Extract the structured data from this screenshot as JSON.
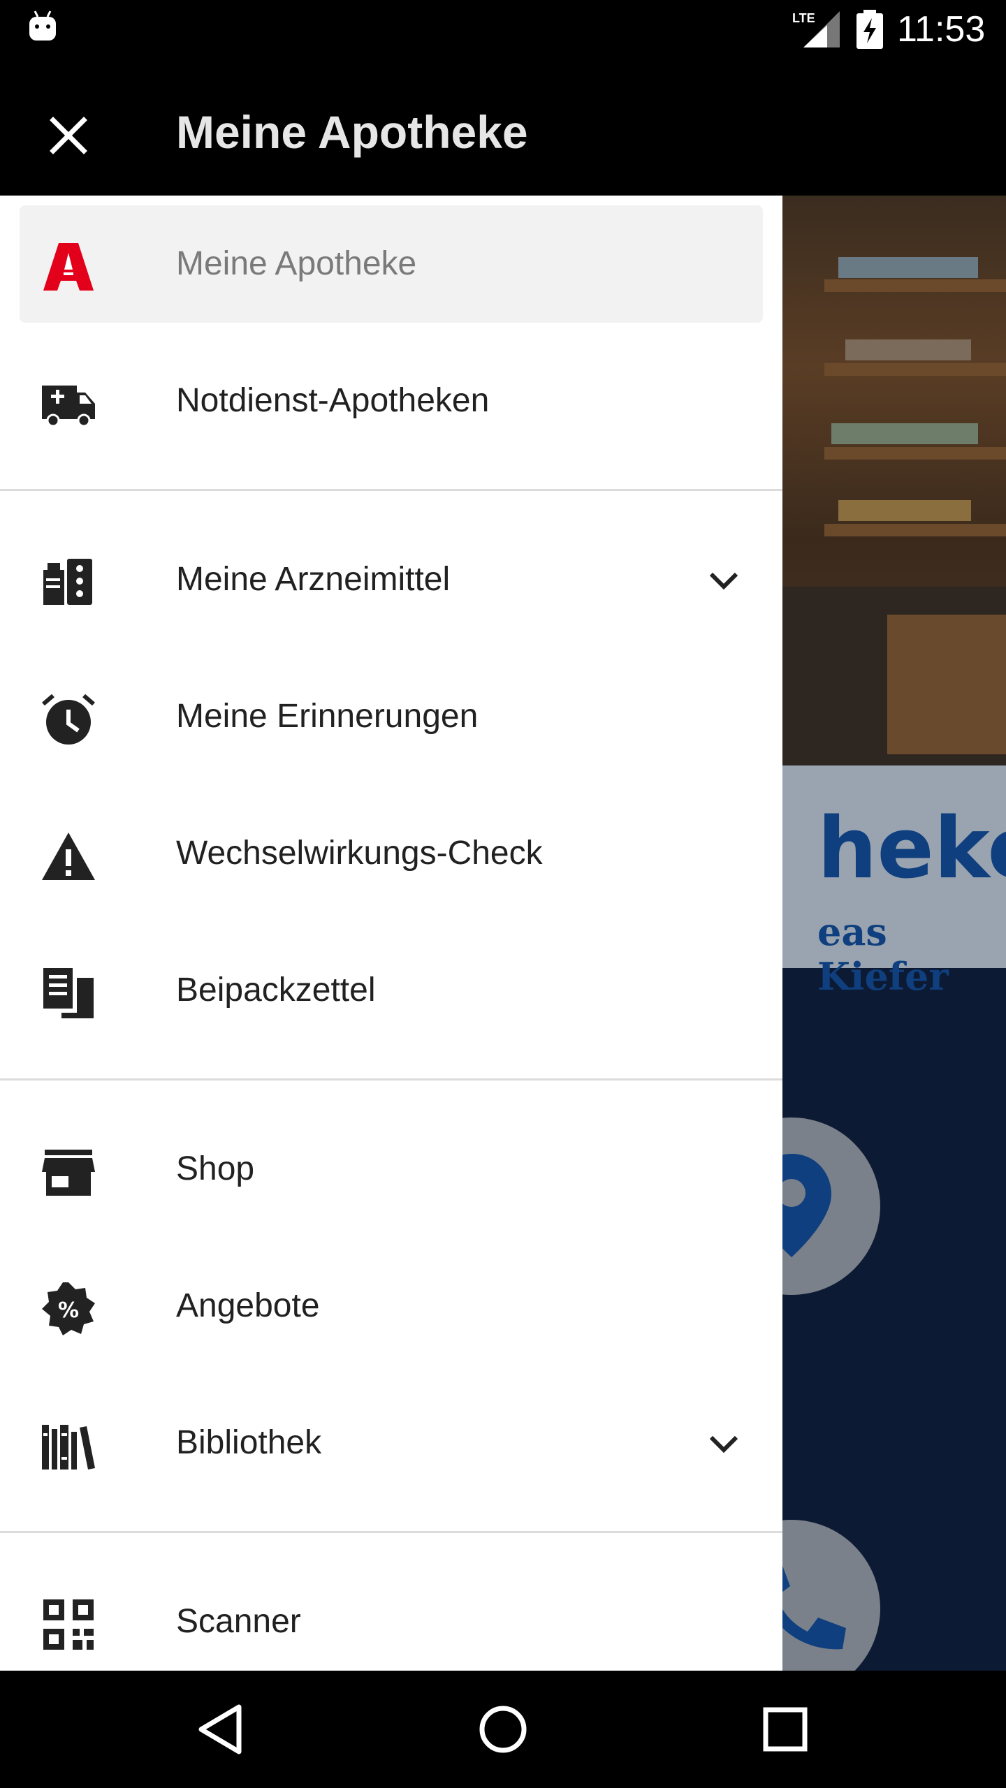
{
  "status_bar": {
    "time": "11:53",
    "network": "LTE",
    "icons": [
      "android-icon",
      "lte-signal-icon",
      "battery-charging-icon"
    ]
  },
  "app_bar": {
    "title": "Meine Apotheke",
    "close_icon": "close-icon"
  },
  "drawer": {
    "sections": [
      {
        "items": [
          {
            "label": "Meine Apotheke",
            "icon": "apotheke-logo-icon",
            "selected": true
          },
          {
            "label": "Notdienst-Apotheken",
            "icon": "ambulance-icon"
          }
        ]
      },
      {
        "items": [
          {
            "label": "Meine Arzneimittel",
            "icon": "medication-icon",
            "expandable": true
          },
          {
            "label": "Meine Erinnerungen",
            "icon": "alarm-clock-icon"
          },
          {
            "label": "Wechselwirkungs-Check",
            "icon": "warning-icon"
          },
          {
            "label": "Beipackzettel",
            "icon": "leaflet-icon"
          }
        ]
      },
      {
        "items": [
          {
            "label": "Shop",
            "icon": "store-icon"
          },
          {
            "label": "Angebote",
            "icon": "discount-badge-icon"
          },
          {
            "label": "Bibliothek",
            "icon": "library-icon",
            "expandable": true
          }
        ]
      },
      {
        "items": [
          {
            "label": "Scanner",
            "icon": "qr-code-icon"
          }
        ]
      }
    ]
  },
  "background": {
    "logo_text_large": "heke",
    "logo_text_small": "eas Kiefer"
  },
  "nav_bar": {
    "icons": [
      "back-icon",
      "home-icon",
      "recents-icon"
    ]
  },
  "colors": {
    "brand_red": "#e3001b",
    "text": "#212121",
    "selected_text": "#7a7a7a",
    "selected_bg": "#f2f2f2",
    "divider": "#dcdcdc",
    "bg_logo_blue": "#0f3f7e"
  }
}
